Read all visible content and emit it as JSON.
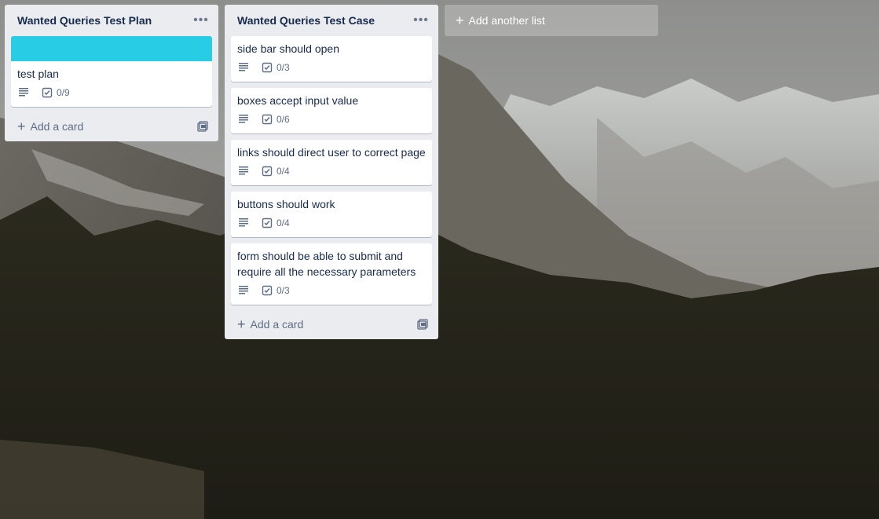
{
  "colors": {
    "list_bg": "#ebecf0",
    "card_cover": "#29cce5",
    "text": "#172b4d",
    "muted": "#5e6c84"
  },
  "lists": [
    {
      "title": "Wanted Queries Test Plan",
      "menu_icon": "ellipsis-icon",
      "add_card_label": "Add a card",
      "cards": [
        {
          "title": "test plan",
          "checklist": "0/9",
          "has_description": true,
          "cover": "#29cce5"
        }
      ]
    },
    {
      "title": "Wanted Queries Test Case",
      "menu_icon": "ellipsis-icon",
      "add_card_label": "Add a card",
      "cards": [
        {
          "title": "side bar should open",
          "checklist": "0/3",
          "has_description": true
        },
        {
          "title": "boxes accept input value",
          "checklist": "0/6",
          "has_description": true
        },
        {
          "title": "links should direct user to correct page",
          "checklist": "0/4",
          "has_description": true
        },
        {
          "title": "buttons should work",
          "checklist": "0/4",
          "has_description": true
        },
        {
          "title": "form should be able to submit and require all the necessary parameters",
          "checklist": "0/3",
          "has_description": true
        }
      ]
    }
  ],
  "add_list_label": "Add another list"
}
